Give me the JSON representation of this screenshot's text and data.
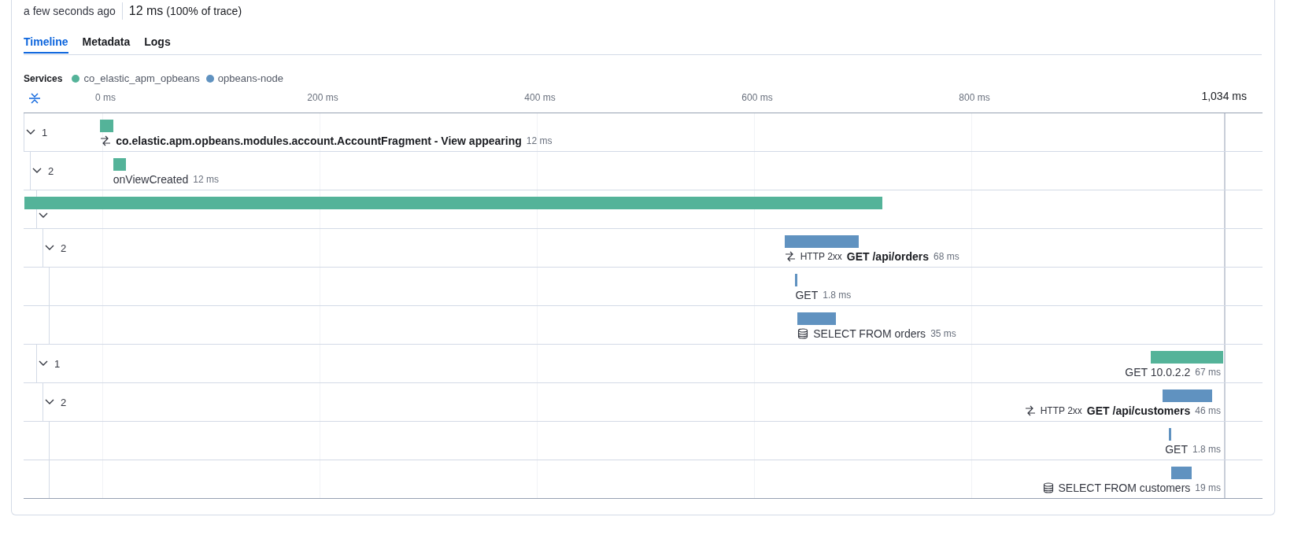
{
  "summary": {
    "age": "a few seconds ago",
    "duration": "12 ms",
    "share": "(100% of trace)"
  },
  "tabs": [
    {
      "label": "Timeline",
      "selected": true
    },
    {
      "label": "Metadata",
      "selected": false
    },
    {
      "label": "Logs",
      "selected": false
    }
  ],
  "services": {
    "label": "Services",
    "items": [
      {
        "name": "co_elastic_apm_opbeans",
        "color": "#54b399"
      },
      {
        "name": "opbeans-node",
        "color": "#6092c0"
      }
    ]
  },
  "axis": {
    "ticks": [
      "0 ms",
      "200 ms",
      "400 ms",
      "600 ms",
      "800 ms"
    ],
    "end": "1,034 ms"
  },
  "waterfall": [
    {
      "kind": "transaction",
      "name": "co.elastic.apm.opbeans.modules.account.AccountFragment - View appearing",
      "duration": "12 ms",
      "color": "#54b399",
      "expanded": true,
      "count": "1",
      "children": [
        {
          "kind": "span",
          "name": "onViewCreated",
          "duration": "12 ms",
          "color": "#54b399",
          "expanded": true,
          "count": "2",
          "children": [
            {
              "kind": "span",
              "color": "#54b399",
              "expanded": true,
              "children": [
                {
                  "kind": "transaction",
                  "status": "HTTP 2xx",
                  "name": "GET /api/orders",
                  "duration": "68 ms",
                  "color": "#6092c0",
                  "expanded": true,
                  "count": "2",
                  "children": [
                    {
                      "kind": "span",
                      "name": "GET",
                      "duration": "1.8 ms",
                      "color": "#6092c0"
                    },
                    {
                      "kind": "db",
                      "name": "SELECT FROM orders",
                      "duration": "35 ms",
                      "color": "#6092c0"
                    }
                  ]
                }
              ]
            },
            {
              "kind": "span",
              "name": "GET 10.0.2.2",
              "duration": "67 ms",
              "color": "#54b399",
              "expanded": true,
              "count": "1",
              "children": [
                {
                  "kind": "transaction",
                  "status": "HTTP 2xx",
                  "name": "GET /api/customers",
                  "duration": "46 ms",
                  "color": "#6092c0",
                  "expanded": true,
                  "count": "2",
                  "children": [
                    {
                      "kind": "span",
                      "name": "GET",
                      "duration": "1.8 ms",
                      "color": "#6092c0"
                    },
                    {
                      "kind": "db",
                      "name": "SELECT FROM customers",
                      "duration": "19 ms",
                      "color": "#6092c0"
                    }
                  ]
                }
              ]
            }
          ]
        }
      ]
    }
  ]
}
